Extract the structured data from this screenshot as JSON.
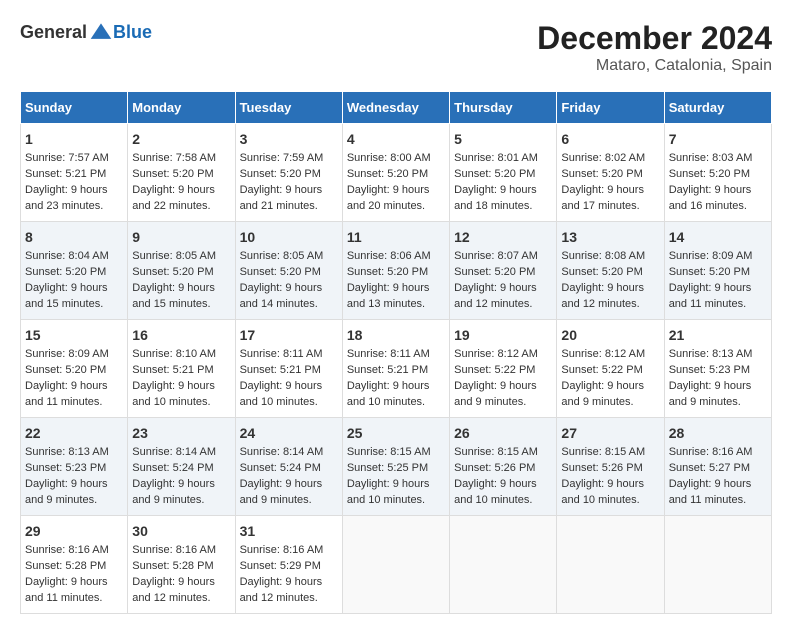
{
  "logo": {
    "general": "General",
    "blue": "Blue"
  },
  "title": "December 2024",
  "subtitle": "Mataro, Catalonia, Spain",
  "days_of_week": [
    "Sunday",
    "Monday",
    "Tuesday",
    "Wednesday",
    "Thursday",
    "Friday",
    "Saturday"
  ],
  "weeks": [
    [
      {
        "day": "1",
        "sunrise": "7:57 AM",
        "sunset": "5:21 PM",
        "daylight": "9 hours and 23 minutes."
      },
      {
        "day": "2",
        "sunrise": "7:58 AM",
        "sunset": "5:20 PM",
        "daylight": "9 hours and 22 minutes."
      },
      {
        "day": "3",
        "sunrise": "7:59 AM",
        "sunset": "5:20 PM",
        "daylight": "9 hours and 21 minutes."
      },
      {
        "day": "4",
        "sunrise": "8:00 AM",
        "sunset": "5:20 PM",
        "daylight": "9 hours and 20 minutes."
      },
      {
        "day": "5",
        "sunrise": "8:01 AM",
        "sunset": "5:20 PM",
        "daylight": "9 hours and 18 minutes."
      },
      {
        "day": "6",
        "sunrise": "8:02 AM",
        "sunset": "5:20 PM",
        "daylight": "9 hours and 17 minutes."
      },
      {
        "day": "7",
        "sunrise": "8:03 AM",
        "sunset": "5:20 PM",
        "daylight": "9 hours and 16 minutes."
      }
    ],
    [
      {
        "day": "8",
        "sunrise": "8:04 AM",
        "sunset": "5:20 PM",
        "daylight": "9 hours and 15 minutes."
      },
      {
        "day": "9",
        "sunrise": "8:05 AM",
        "sunset": "5:20 PM",
        "daylight": "9 hours and 15 minutes."
      },
      {
        "day": "10",
        "sunrise": "8:05 AM",
        "sunset": "5:20 PM",
        "daylight": "9 hours and 14 minutes."
      },
      {
        "day": "11",
        "sunrise": "8:06 AM",
        "sunset": "5:20 PM",
        "daylight": "9 hours and 13 minutes."
      },
      {
        "day": "12",
        "sunrise": "8:07 AM",
        "sunset": "5:20 PM",
        "daylight": "9 hours and 12 minutes."
      },
      {
        "day": "13",
        "sunrise": "8:08 AM",
        "sunset": "5:20 PM",
        "daylight": "9 hours and 12 minutes."
      },
      {
        "day": "14",
        "sunrise": "8:09 AM",
        "sunset": "5:20 PM",
        "daylight": "9 hours and 11 minutes."
      }
    ],
    [
      {
        "day": "15",
        "sunrise": "8:09 AM",
        "sunset": "5:20 PM",
        "daylight": "9 hours and 11 minutes."
      },
      {
        "day": "16",
        "sunrise": "8:10 AM",
        "sunset": "5:21 PM",
        "daylight": "9 hours and 10 minutes."
      },
      {
        "day": "17",
        "sunrise": "8:11 AM",
        "sunset": "5:21 PM",
        "daylight": "9 hours and 10 minutes."
      },
      {
        "day": "18",
        "sunrise": "8:11 AM",
        "sunset": "5:21 PM",
        "daylight": "9 hours and 10 minutes."
      },
      {
        "day": "19",
        "sunrise": "8:12 AM",
        "sunset": "5:22 PM",
        "daylight": "9 hours and 9 minutes."
      },
      {
        "day": "20",
        "sunrise": "8:12 AM",
        "sunset": "5:22 PM",
        "daylight": "9 hours and 9 minutes."
      },
      {
        "day": "21",
        "sunrise": "8:13 AM",
        "sunset": "5:23 PM",
        "daylight": "9 hours and 9 minutes."
      }
    ],
    [
      {
        "day": "22",
        "sunrise": "8:13 AM",
        "sunset": "5:23 PM",
        "daylight": "9 hours and 9 minutes."
      },
      {
        "day": "23",
        "sunrise": "8:14 AM",
        "sunset": "5:24 PM",
        "daylight": "9 hours and 9 minutes."
      },
      {
        "day": "24",
        "sunrise": "8:14 AM",
        "sunset": "5:24 PM",
        "daylight": "9 hours and 9 minutes."
      },
      {
        "day": "25",
        "sunrise": "8:15 AM",
        "sunset": "5:25 PM",
        "daylight": "9 hours and 10 minutes."
      },
      {
        "day": "26",
        "sunrise": "8:15 AM",
        "sunset": "5:26 PM",
        "daylight": "9 hours and 10 minutes."
      },
      {
        "day": "27",
        "sunrise": "8:15 AM",
        "sunset": "5:26 PM",
        "daylight": "9 hours and 10 minutes."
      },
      {
        "day": "28",
        "sunrise": "8:16 AM",
        "sunset": "5:27 PM",
        "daylight": "9 hours and 11 minutes."
      }
    ],
    [
      {
        "day": "29",
        "sunrise": "8:16 AM",
        "sunset": "5:28 PM",
        "daylight": "9 hours and 11 minutes."
      },
      {
        "day": "30",
        "sunrise": "8:16 AM",
        "sunset": "5:28 PM",
        "daylight": "9 hours and 12 minutes."
      },
      {
        "day": "31",
        "sunrise": "8:16 AM",
        "sunset": "5:29 PM",
        "daylight": "9 hours and 12 minutes."
      },
      null,
      null,
      null,
      null
    ]
  ],
  "labels": {
    "sunrise": "Sunrise:",
    "sunset": "Sunset:",
    "daylight": "Daylight:"
  }
}
